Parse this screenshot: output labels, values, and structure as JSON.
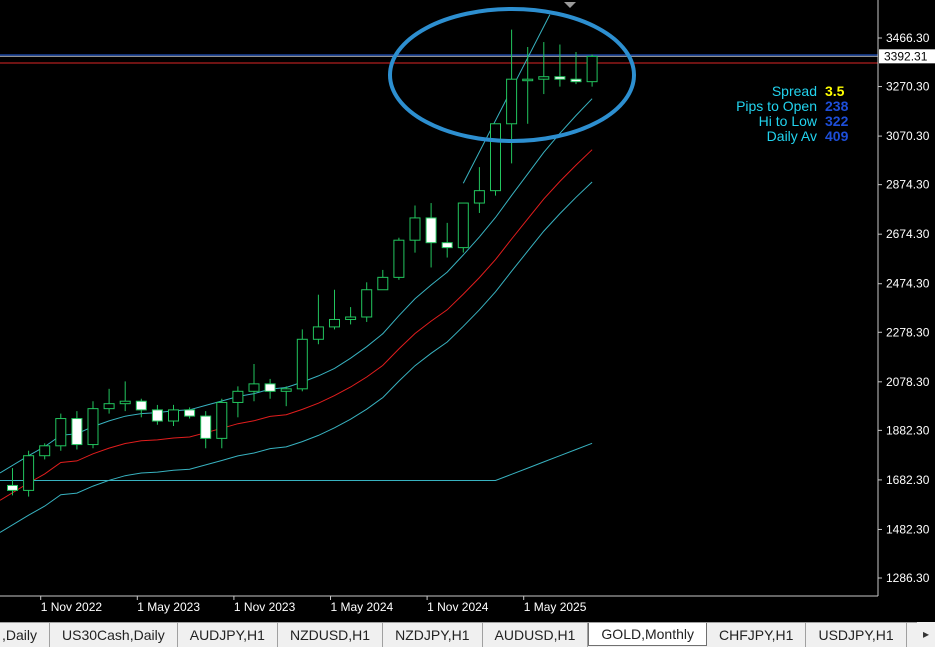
{
  "window": {
    "symbol": "GOLD",
    "timeframe": "Monthly"
  },
  "colors": {
    "background": "#000000",
    "bull_candle": "#22c55e",
    "bear_candle": "#ffffff",
    "ma_red": "#e11d1d",
    "band_cyan": "#38b2c0",
    "circle": "#2d8fd0",
    "info_label": "#22d3ee",
    "spread_value": "#ffff00",
    "stat_value": "#1d4ed8",
    "bid_line": "#c0c0c0",
    "red_hline": "#dc2626",
    "blue_hline": "#2563eb"
  },
  "price_axis": {
    "ticks": [
      "3466.30",
      "3270.30",
      "3070.30",
      "2874.30",
      "2674.30",
      "2474.30",
      "2278.30",
      "2078.30",
      "1882.30",
      "1682.30",
      "1482.30",
      "1286.30"
    ],
    "current_price": "3392.31"
  },
  "time_axis": {
    "ticks": [
      "1 Nov 2022",
      "1 May 2023",
      "1 Nov 2023",
      "1 May 2024",
      "1 Nov 2024",
      "1 May 2025"
    ]
  },
  "info_panel": {
    "rows": [
      {
        "label": "Spread",
        "value": "3.5",
        "value_color": "#ffff00"
      },
      {
        "label": "Pips to Open",
        "value": "238",
        "value_color": "#1d4ed8"
      },
      {
        "label": "Hi to Low",
        "value": "322",
        "value_color": "#1d4ed8"
      },
      {
        "label": "Daily Av",
        "value": "409",
        "value_color": "#1d4ed8"
      }
    ]
  },
  "tabs": [
    {
      "label": ",Daily",
      "active": false
    },
    {
      "label": "US30Cash,Daily",
      "active": false
    },
    {
      "label": "AUDJPY,H1",
      "active": false
    },
    {
      "label": "NZDUSD,H1",
      "active": false
    },
    {
      "label": "NZDJPY,H1",
      "active": false
    },
    {
      "label": "AUDUSD,H1",
      "active": false
    },
    {
      "label": "GOLD,Monthly",
      "active": true
    },
    {
      "label": "CHFJPY,H1",
      "active": false
    },
    {
      "label": "USDJPY,H1",
      "active": false
    }
  ],
  "scroll_icon": "triangle-right-icon",
  "chart_data": {
    "type": "candlestick",
    "timeframe": "Monthly",
    "x_start": "2022-09",
    "ylim": [
      1286.3,
      3466.3
    ],
    "candles": [
      {
        "o": 1660,
        "h": 1730,
        "l": 1620,
        "c": 1640
      },
      {
        "o": 1640,
        "h": 1800,
        "l": 1615,
        "c": 1780
      },
      {
        "o": 1780,
        "h": 1830,
        "l": 1765,
        "c": 1820
      },
      {
        "o": 1820,
        "h": 1950,
        "l": 1800,
        "c": 1930
      },
      {
        "o": 1930,
        "h": 1960,
        "l": 1805,
        "c": 1825
      },
      {
        "o": 1825,
        "h": 2000,
        "l": 1810,
        "c": 1970
      },
      {
        "o": 1970,
        "h": 2050,
        "l": 1950,
        "c": 1990
      },
      {
        "o": 1990,
        "h": 2080,
        "l": 1960,
        "c": 2000
      },
      {
        "o": 2000,
        "h": 2010,
        "l": 1935,
        "c": 1965
      },
      {
        "o": 1965,
        "h": 1985,
        "l": 1905,
        "c": 1920
      },
      {
        "o": 1920,
        "h": 1985,
        "l": 1900,
        "c": 1965
      },
      {
        "o": 1965,
        "h": 1975,
        "l": 1930,
        "c": 1940
      },
      {
        "o": 1940,
        "h": 1960,
        "l": 1810,
        "c": 1850
      },
      {
        "o": 1850,
        "h": 2010,
        "l": 1810,
        "c": 1995
      },
      {
        "o": 1995,
        "h": 2060,
        "l": 1935,
        "c": 2040
      },
      {
        "o": 2040,
        "h": 2150,
        "l": 2000,
        "c": 2070
      },
      {
        "o": 2070,
        "h": 2090,
        "l": 2010,
        "c": 2040
      },
      {
        "o": 2040,
        "h": 2060,
        "l": 1980,
        "c": 2050
      },
      {
        "o": 2050,
        "h": 2290,
        "l": 2040,
        "c": 2250
      },
      {
        "o": 2250,
        "h": 2430,
        "l": 2230,
        "c": 2300
      },
      {
        "o": 2300,
        "h": 2450,
        "l": 2290,
        "c": 2330
      },
      {
        "o": 2330,
        "h": 2380,
        "l": 2310,
        "c": 2340
      },
      {
        "o": 2340,
        "h": 2480,
        "l": 2320,
        "c": 2450
      },
      {
        "o": 2450,
        "h": 2530,
        "l": 2460,
        "c": 2500
      },
      {
        "o": 2500,
        "h": 2660,
        "l": 2490,
        "c": 2650
      },
      {
        "o": 2650,
        "h": 2790,
        "l": 2600,
        "c": 2740
      },
      {
        "o": 2740,
        "h": 2800,
        "l": 2540,
        "c": 2640
      },
      {
        "o": 2640,
        "h": 2720,
        "l": 2580,
        "c": 2620
      },
      {
        "o": 2620,
        "h": 2790,
        "l": 2600,
        "c": 2800
      },
      {
        "o": 2800,
        "h": 2945,
        "l": 2760,
        "c": 2850
      },
      {
        "o": 2850,
        "h": 3060,
        "l": 2830,
        "c": 3120
      },
      {
        "o": 3120,
        "h": 3500,
        "l": 2960,
        "c": 3300
      },
      {
        "o": 3300,
        "h": 3430,
        "l": 3120,
        "c": 3300
      },
      {
        "o": 3300,
        "h": 3450,
        "l": 3240,
        "c": 3310
      },
      {
        "o": 3310,
        "h": 3440,
        "l": 3270,
        "c": 3300
      },
      {
        "o": 3300,
        "h": 3410,
        "l": 3280,
        "c": 3290
      },
      {
        "o": 3290,
        "h": 3400,
        "l": 3270,
        "c": 3392
      }
    ]
  }
}
